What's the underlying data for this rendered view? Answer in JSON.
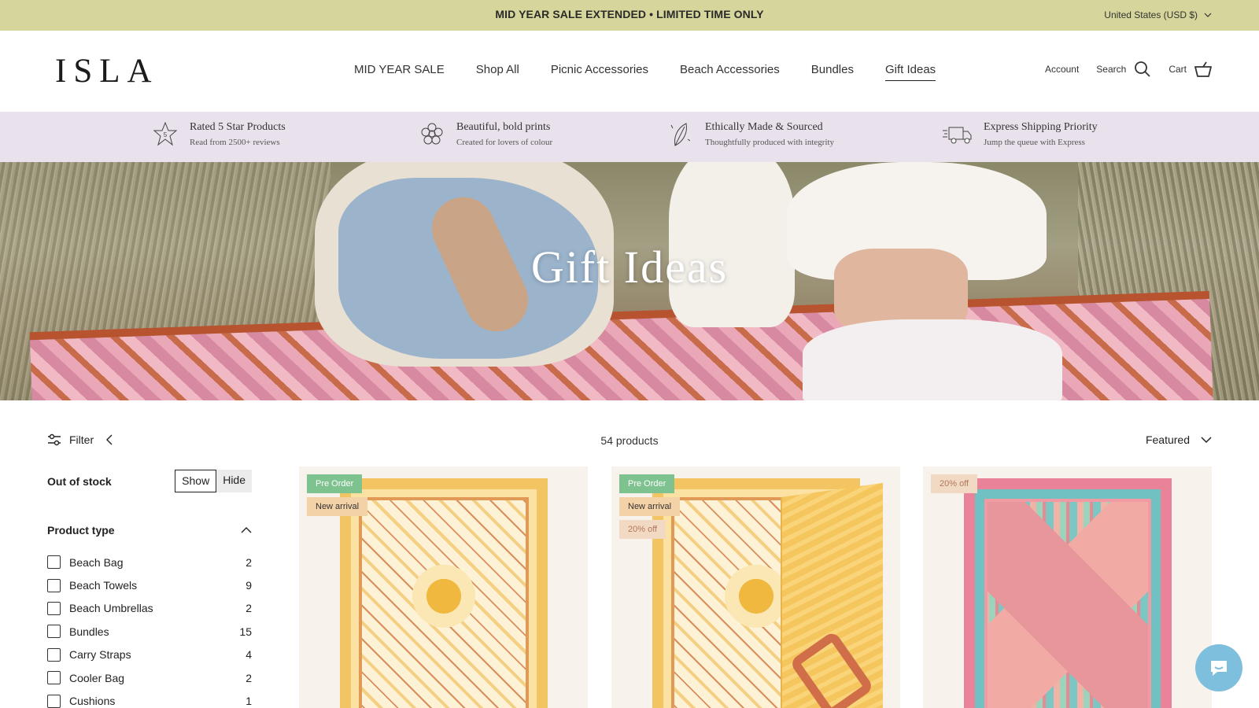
{
  "announcement": {
    "text": "MID YEAR SALE EXTENDED • LIMITED TIME ONLY",
    "currency": "United States (USD $)"
  },
  "header": {
    "logo": "ISLA",
    "nav": [
      "MID YEAR SALE",
      "Shop All",
      "Picnic Accessories",
      "Beach Accessories",
      "Bundles",
      "Gift Ideas"
    ],
    "active_nav": "Gift Ideas",
    "account": "Account",
    "search": "Search",
    "cart": "Cart"
  },
  "usp": [
    {
      "icon": "star-icon",
      "title": "Rated 5 Star Products",
      "subtitle": "Read from 2500+ reviews"
    },
    {
      "icon": "flower-icon",
      "title": "Beautiful, bold prints",
      "subtitle": "Created for lovers of colour"
    },
    {
      "icon": "leaf-icon",
      "title": "Ethically Made & Sourced",
      "subtitle": "Thoughtfully produced with integrity"
    },
    {
      "icon": "truck-icon",
      "title": "Express Shipping Priority",
      "subtitle": "Jump the queue with Express"
    }
  ],
  "hero": {
    "title": "Gift Ideas"
  },
  "toolbar": {
    "filter_label": "Filter",
    "count": "54 products",
    "sort_label": "Featured"
  },
  "sidebar": {
    "out_of_stock_label": "Out of stock",
    "show_label": "Show",
    "hide_label": "Hide",
    "product_type_label": "Product type",
    "product_types": [
      {
        "label": "Beach Bag",
        "count": "2"
      },
      {
        "label": "Beach Towels",
        "count": "9"
      },
      {
        "label": "Beach Umbrellas",
        "count": "2"
      },
      {
        "label": "Bundles",
        "count": "15"
      },
      {
        "label": "Carry Straps",
        "count": "4"
      },
      {
        "label": "Cooler Bag",
        "count": "2"
      },
      {
        "label": "Cushions",
        "count": "1"
      }
    ]
  },
  "products": [
    {
      "badges": [
        "Pre Order",
        "New arrival"
      ]
    },
    {
      "badges": [
        "Pre Order",
        "New arrival",
        "20% off"
      ]
    },
    {
      "badges": [
        "20% off"
      ]
    }
  ],
  "colors": {
    "announcement_bg": "#d6d59b",
    "usp_bg": "#e9e2ec",
    "pre_order": "#7ec28f",
    "new_arrival": "#f4d2a8",
    "sale": "#f2d9c3",
    "chat": "#7fbfde"
  }
}
